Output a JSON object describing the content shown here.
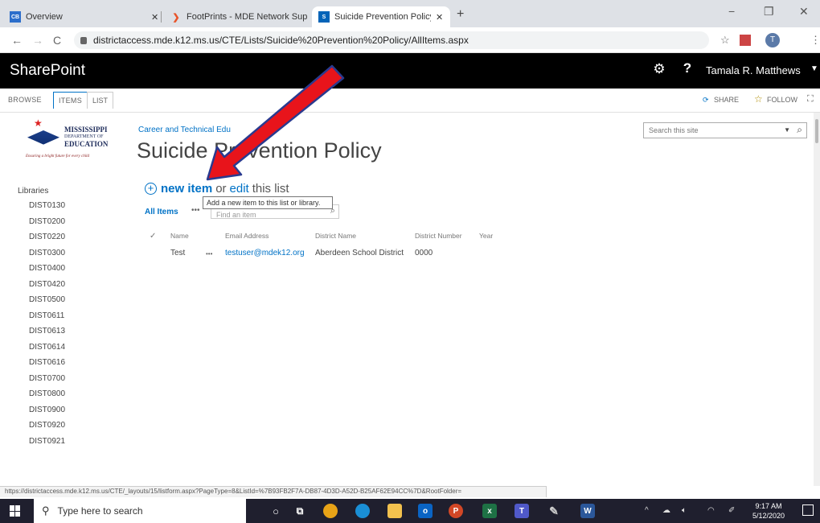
{
  "browser": {
    "tabs": [
      {
        "favicon": "CB",
        "title": "Overview",
        "favicon_color": "#2c6ecb"
      },
      {
        "favicon": "❯",
        "title": "FootPrints - MDE Network Suppo",
        "favicon_color": "#e8542a"
      },
      {
        "favicon": "S",
        "title": "Suicide Prevention Policy - All Ite",
        "favicon_color": "#0364b8"
      }
    ],
    "close_glyph": "✕",
    "new_tab_glyph": "+",
    "url": "districtaccess.mde.k12.ms.us/CTE/Lists/Suicide%20Prevention%20Policy/AllItems.aspx",
    "profile_initial": "T",
    "window_controls": [
      "−",
      "❐",
      "✕"
    ]
  },
  "suitebar": {
    "brand": "SharePoint",
    "help": "?",
    "user_name": "Tamala R. Matthews"
  },
  "ribbon": {
    "tabs": [
      "BROWSE",
      "ITEMS",
      "LIST"
    ],
    "share": "SHARE",
    "follow": "FOLLOW"
  },
  "logo": {
    "line1": "MISSISSIPPI",
    "line2": "DEPARTMENT OF",
    "line3": "EDUCATION",
    "tagline": "Ensuring a bright future for every child"
  },
  "site": {
    "breadcrumb": "Career and Technical Edu",
    "page_title": "Suicide Prevention Policy",
    "search_placeholder": "Search this site"
  },
  "leftnav": {
    "heading": "Libraries",
    "items": [
      "DIST0130",
      "DIST0200",
      "DIST0220",
      "DIST0300",
      "DIST0400",
      "DIST0420",
      "DIST0500",
      "DIST0611",
      "DIST0613",
      "DIST0614",
      "DIST0616",
      "DIST0700",
      "DIST0800",
      "DIST0900",
      "DIST0920",
      "DIST0921"
    ]
  },
  "list": {
    "new_item": "new item",
    "or": "or",
    "edit": "edit",
    "this_list": "this list",
    "view_name": "All Items",
    "view_menu": "•••",
    "find_placeholder": "Find an item",
    "tooltip": "Add a new item to this list or library.",
    "check_glyph": "✓",
    "columns": [
      "Name",
      "Email Address",
      "District Name",
      "District Number",
      "Year"
    ],
    "rows": [
      {
        "name": "Test",
        "menu": "•••",
        "email": "testuser@mdek12.org",
        "district_name": "Aberdeen School District",
        "district_number": "0000",
        "year": ""
      }
    ]
  },
  "status_url": "https://districtaccess.mde.k12.ms.us/CTE/_layouts/15/listform.aspx?PageType=8&ListId=%7B93FB2F7A-DB87-4D3D-A52D-B25AF62E94CC%7D&RootFolder=",
  "taskbar": {
    "search_placeholder": "Type here to search",
    "time": "9:17 AM",
    "date": "5/12/2020"
  },
  "colors": {
    "accent": "#0072c6",
    "suitebar": "#000000",
    "arrow": "#e8141b"
  }
}
